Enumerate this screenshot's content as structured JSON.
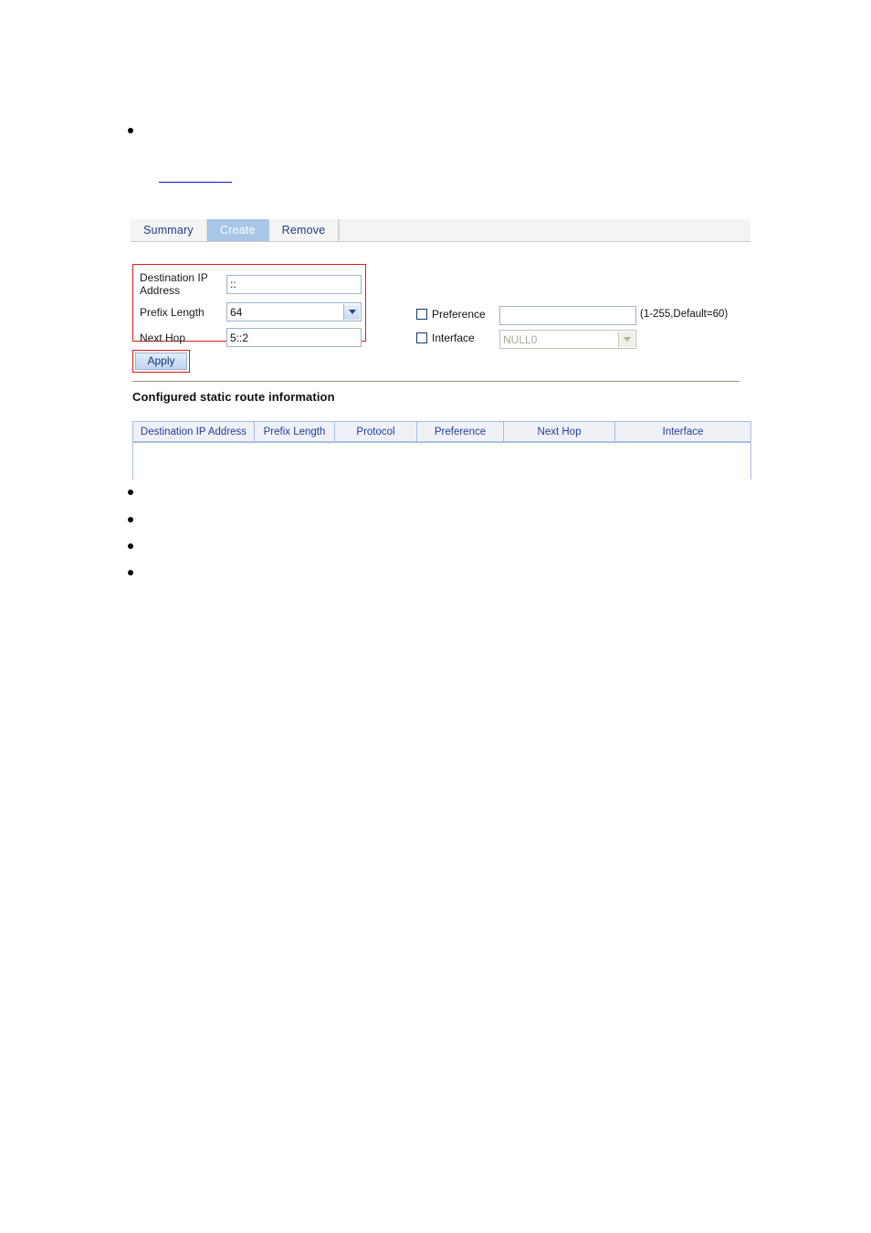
{
  "bullets_top": [
    {
      "text": ""
    }
  ],
  "link": {
    "label": ""
  },
  "bullets_bottom": [
    {
      "text": ""
    },
    {
      "text": ""
    },
    {
      "text": ""
    },
    {
      "text": ""
    }
  ],
  "tabs": [
    {
      "label": "Summary",
      "active": false
    },
    {
      "label": "Create",
      "active": true
    },
    {
      "label": "Remove",
      "active": false
    }
  ],
  "form": {
    "destination_ip": {
      "label": "Destination IP\nAddress",
      "value": "::",
      "placeholder": ""
    },
    "prefix_length": {
      "label": "Prefix Length",
      "value": "64"
    },
    "next_hop": {
      "label": "Next Hop",
      "value": "5::2",
      "placeholder": ""
    },
    "preference": {
      "label": "Preference",
      "checked": false,
      "value": "",
      "placeholder": "",
      "hint": "(1-255,Default=60)"
    },
    "interface": {
      "label": "Interface",
      "checked": false,
      "value": "NULL0",
      "disabled": true
    },
    "apply_label": "Apply"
  },
  "section": {
    "title": "Configured static route information"
  },
  "table": {
    "columns": [
      "Destination IP Address",
      "Prefix Length",
      "Protocol",
      "Preference",
      "Next Hop",
      "Interface"
    ],
    "rows": []
  },
  "colors": {
    "highlight_red": "#e01b1b",
    "active_tab_bg": "#a8c6e8",
    "link_blue": "#1414cc",
    "table_header_text": "#22409b",
    "divider": "#9c9771"
  }
}
